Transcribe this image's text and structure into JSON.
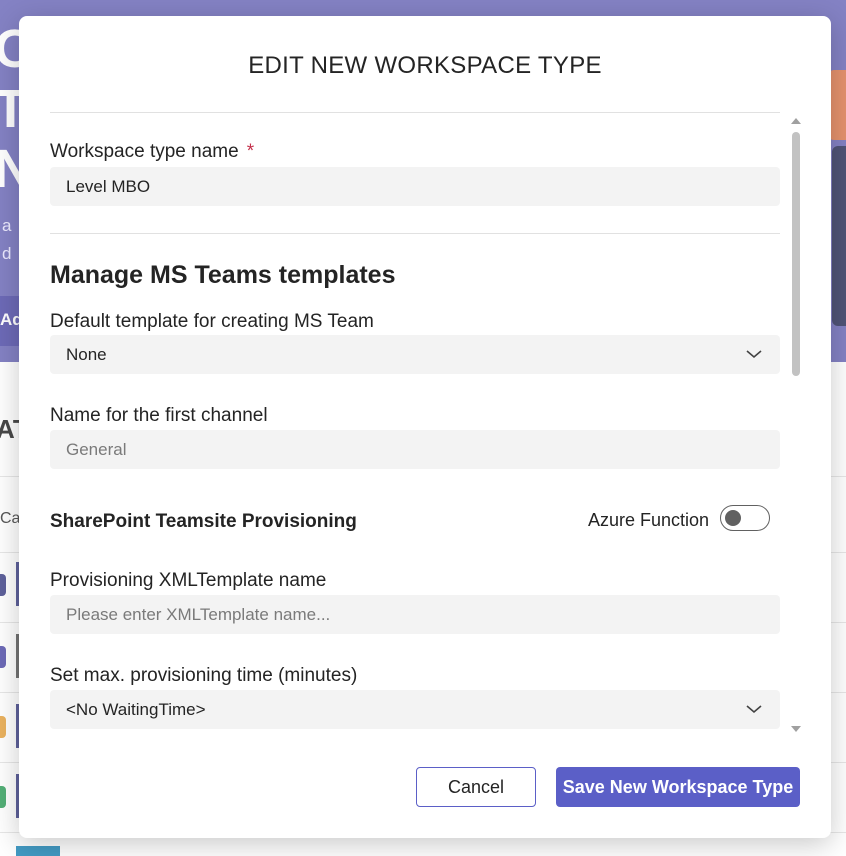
{
  "background": {
    "hero_letters": [
      "O",
      "T",
      "N"
    ],
    "hero_small": [
      "a",
      "d"
    ],
    "add_button_label": "Add",
    "section_title": "AT",
    "column_label": "Cat",
    "row_chip_colors": [
      "#3b3f86",
      "#4d4aa8",
      "#e6a23c",
      "#2e9e5a"
    ]
  },
  "dialog": {
    "title": "EDIT NEW WORKSPACE TYPE",
    "workspace_type_name": {
      "label": "Workspace type name",
      "required_mark": "*",
      "value": "Level MBO"
    },
    "teams_section": {
      "heading": "Manage MS Teams templates",
      "default_template": {
        "label": "Default template for creating MS Team",
        "value": "None"
      },
      "first_channel": {
        "label": "Name for the first channel",
        "placeholder": "General"
      }
    },
    "sharepoint_section": {
      "heading": "SharePoint Teamsite Provisioning",
      "toggle_label": "Azure Function",
      "toggle_on": false,
      "xml_template": {
        "label": "Provisioning XMLTemplate name",
        "placeholder": "Please enter XMLTemplate name..."
      },
      "max_time": {
        "label": "Set max. provisioning time (minutes)",
        "value": "<No WaitingTime>"
      }
    },
    "buttons": {
      "cancel": "Cancel",
      "save": "Save New Workspace Type"
    }
  },
  "colors": {
    "accent": "#5b5fc7",
    "required": "#c4314b",
    "hero": "#6a67b8"
  }
}
